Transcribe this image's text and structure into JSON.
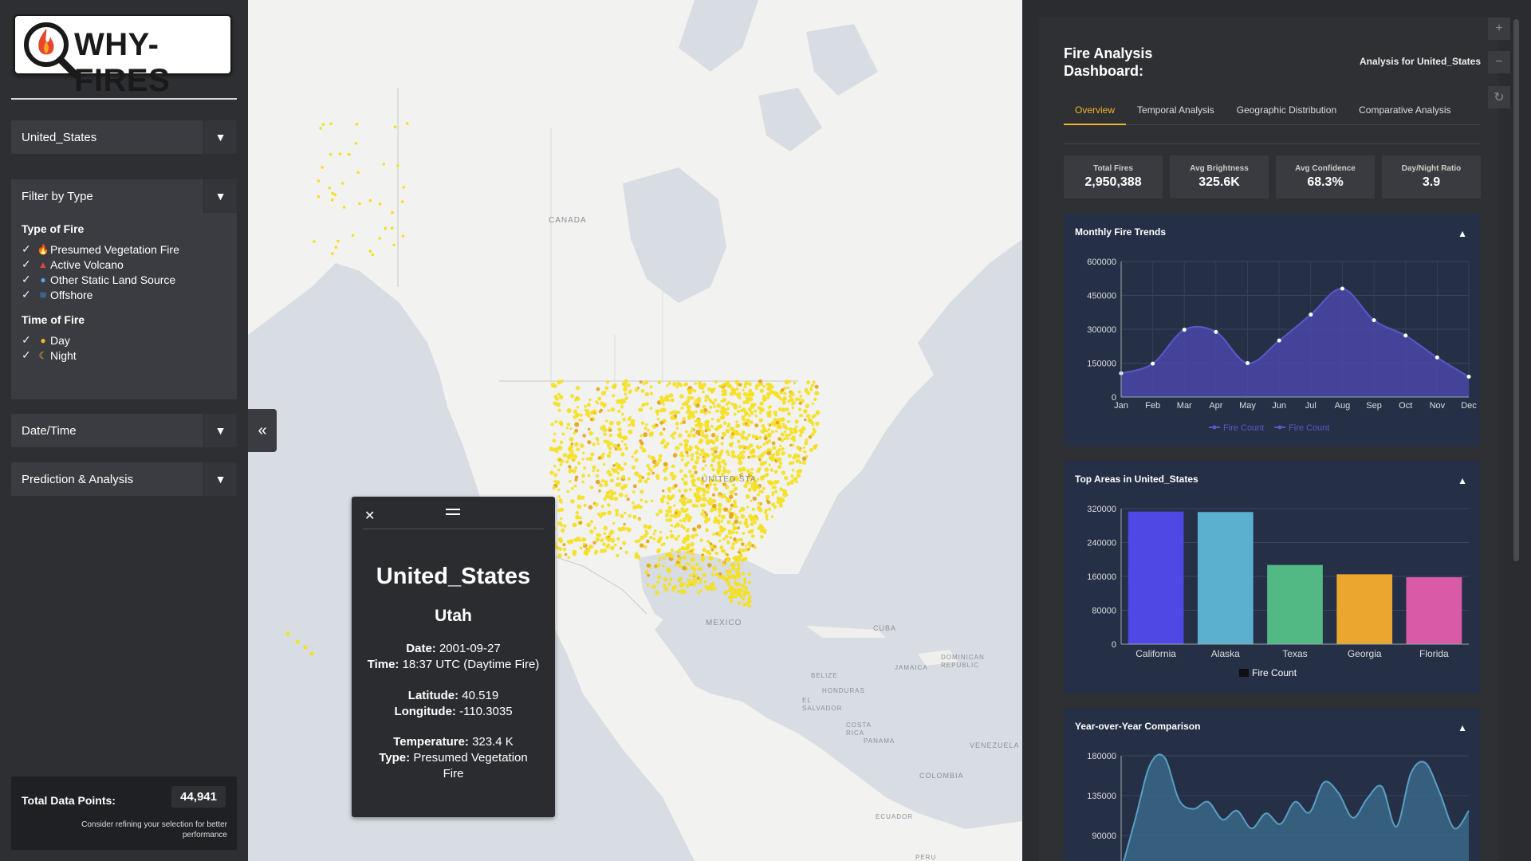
{
  "app": {
    "logo_text": "WHY-FIRES"
  },
  "sidebar": {
    "country_select": "United_States",
    "filter_header": "Filter by Type",
    "type_title": "Type of Fire",
    "types": [
      {
        "label": "Presumed Vegetation Fire",
        "icon": "flame-icon"
      },
      {
        "label": "Active Volcano",
        "icon": "volcano-icon"
      },
      {
        "label": "Other Static Land Source",
        "icon": "pin-icon"
      },
      {
        "label": "Offshore",
        "icon": "wave-icon"
      }
    ],
    "time_title": "Time of Fire",
    "times": [
      {
        "label": "Day",
        "icon": "sun-icon"
      },
      {
        "label": "Night",
        "icon": "moon-icon"
      }
    ],
    "date_header": "Date/Time",
    "prediction_header": "Prediction & Analysis",
    "total_label": "Total Data Points:",
    "total_value": "44,941",
    "total_note": "Consider refining your selection for better performance"
  },
  "map": {
    "labels": {
      "canada": "CANADA",
      "united_states": "UNITED STA",
      "mexico": "MEXICO",
      "cuba": "CUBA",
      "dominican": "DOMINICAN REPUBLIC",
      "jamaica": "JAMAICA",
      "belize": "BELIZE",
      "honduras": "HONDURAS",
      "el_salvador": "EL SALVADOR",
      "costa_rica": "COSTA RICA",
      "panama": "PANAMA",
      "venezuela": "VENEZUELA",
      "colombia": "COLOMBIA",
      "ecuador": "ECUADOR",
      "peru": "PERU"
    },
    "fire_color": "#f5e020"
  },
  "popup": {
    "title": "United_States",
    "region": "Utah",
    "date_label": "Date:",
    "date": "2001-09-27",
    "time_label": "Time:",
    "time": "18:37 UTC (Daytime Fire)",
    "lat_label": "Latitude:",
    "lat": "40.519",
    "lon_label": "Longitude:",
    "lon": "-110.3035",
    "temp_label": "Temperature:",
    "temp": "323.4 K",
    "type_label": "Type:",
    "type": "Presumed Vegetation Fire"
  },
  "dashboard": {
    "title": "Fire Analysis Dashboard:",
    "subtitle": "Analysis for United_States",
    "tabs": [
      "Overview",
      "Temporal Analysis",
      "Geographic Distribution",
      "Comparative Analysis"
    ],
    "stats": [
      {
        "label": "Total Fires",
        "value": "2,950,388"
      },
      {
        "label": "Avg Brightness",
        "value": "325.6K"
      },
      {
        "label": "Avg Confidence",
        "value": "68.3%"
      },
      {
        "label": "Day/Night Ratio",
        "value": "3.9"
      }
    ],
    "monthly_title": "Monthly Fire Trends",
    "areas_title": "Top Areas in United_States",
    "yoy_title": "Year-over-Year Comparison",
    "accent": "#f0b429"
  },
  "chart_data": [
    {
      "type": "area",
      "title": "Monthly Fire Trends",
      "categories": [
        "Jan",
        "Feb",
        "Mar",
        "Apr",
        "May",
        "Jun",
        "Jul",
        "Aug",
        "Sep",
        "Oct",
        "Nov",
        "Dec"
      ],
      "series": [
        {
          "name": "Fire Count",
          "values": [
            105000,
            148000,
            298000,
            288000,
            150000,
            250000,
            365000,
            480000,
            340000,
            272000,
            175000,
            90000
          ]
        }
      ],
      "legend": [
        "Fire Count",
        "Fire Count"
      ],
      "ylim": [
        0,
        600000
      ],
      "yticks": [
        0,
        150000,
        300000,
        450000,
        600000
      ],
      "color": "#4b47a8"
    },
    {
      "type": "bar",
      "title": "Top Areas in United_States",
      "categories": [
        "California",
        "Alaska",
        "Texas",
        "Georgia",
        "Florida"
      ],
      "series": [
        {
          "name": "Fire Count",
          "values": [
            313000,
            312000,
            187000,
            165000,
            158000
          ]
        }
      ],
      "colors": [
        "#5048e5",
        "#5bb0d0",
        "#52b884",
        "#eaa62e",
        "#d95aa6"
      ],
      "ylim": [
        0,
        320000
      ],
      "yticks": [
        0,
        80000,
        160000,
        240000,
        320000
      ]
    },
    {
      "type": "area",
      "title": "Year-over-Year Comparison",
      "x": [
        0,
        1,
        2,
        3,
        4,
        5,
        6,
        7,
        8,
        9,
        10,
        11,
        12,
        13,
        14,
        15,
        16,
        17,
        18,
        19,
        20,
        21,
        22,
        23,
        24
      ],
      "series": [
        {
          "values": [
            50000,
            110000,
            170000,
            178000,
            130000,
            120000,
            128000,
            108000,
            118000,
            98000,
            115000,
            103000,
            128000,
            116000,
            150000,
            138000,
            110000,
            132000,
            145000,
            100000,
            160000,
            172000,
            138000,
            98000,
            118000
          ]
        }
      ],
      "yticks": [
        90000,
        135000,
        180000
      ],
      "color": "#3a6b8a"
    }
  ]
}
